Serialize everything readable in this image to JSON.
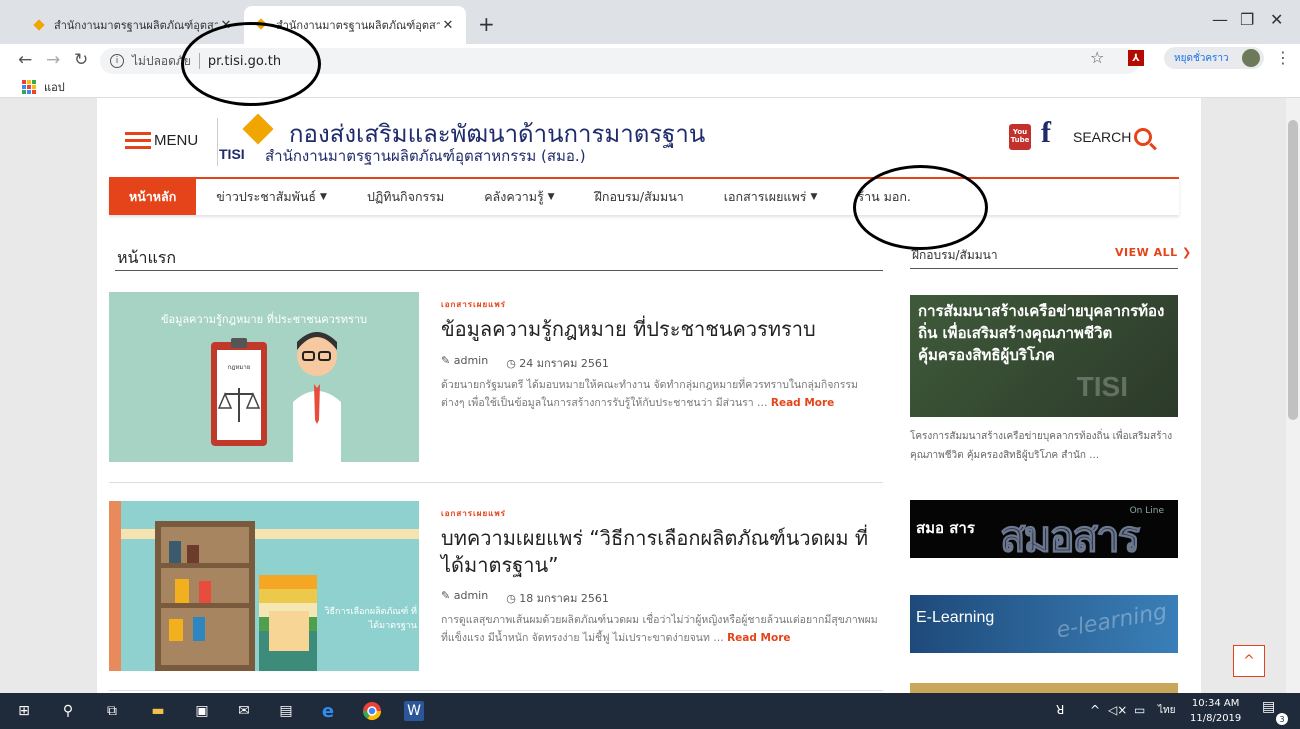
{
  "browser": {
    "tabs": [
      {
        "title": "สำนักงานมาตรฐานผลิตภัณฑ์อุตสาหกรรม",
        "active": false
      },
      {
        "title": "สำนักงานมาตรฐานผลิตภัณฑ์อุตสาหกรรม",
        "active": true
      }
    ],
    "new_tab": "+",
    "address": {
      "security_label": "ไม่ปลอดภัย",
      "url": "pr.tisi.go.th"
    },
    "profile_label": "หยุดชั่วคราว",
    "bookmarks": {
      "apps_label": "แอป"
    }
  },
  "site": {
    "menu_label": "MENU",
    "logo_line1": "กองส่งเสริมและพัฒนาด้านการมาตรฐาน",
    "logo_tisi": "TISI",
    "logo_line2": "สำนักงานมาตรฐานผลิตภัณฑ์อุตสาหกรรม (สมอ.)",
    "youtube_top": "You",
    "youtube_bottom": "Tube",
    "facebook": "f",
    "search_label": "SEARCH",
    "nav": {
      "home": "หน้าหลัก",
      "news": "ข่าวประชาสัมพันธ์",
      "activities": "ปฏิทินกิจกรรม",
      "knowledge": "คลังความรู้",
      "training": "ฝึกอบรม/สัมมนา",
      "documents": "เอกสารเผยแพร่",
      "shop": "ร้าน มอก."
    },
    "section_title": "หน้าแรก",
    "posts": [
      {
        "category": "เอกสารเผยแพร่",
        "thumb_caption": "ข้อมูลความรู้กฎหมาย ที่ประชาชนควรทราบ",
        "thumb_label": "กฎหมาย",
        "title": "ข้อมูลความรู้กฎหมาย ที่ประชาชนควรทราบ",
        "author": "admin",
        "date": "24 มกราคม 2561",
        "excerpt": "ด้วยนายกรัฐมนตรี ได้มอบหมายให้คณะทำงาน จัดทำกลุ่มกฎหมายที่ควรทราบในกลุ่มกิจกรรมต่างๆ เพื่อใช้เป็นข้อมูลในการสร้างการรับรู้ให้กับประชาชนว่า มีส่วนรา …",
        "read_more": "Read More"
      },
      {
        "category": "เอกสารเผยแพร่",
        "thumb_caption": "วิธีการเลือกผลิตภัณฑ์ ที่ได้มาตรฐาน",
        "title": "บทความเผยแพร่ “วิธีการเลือกผลิตภัณฑ์นวดผม ที่ได้มาตรฐาน”",
        "author": "admin",
        "date": "18 มกราคม 2561",
        "excerpt": "การดูแลสุขภาพเส้นผมด้วยผลิตภัณฑ์นวดผม เชื่อว่าไม่ว่าผู้หญิงหรือผู้ชายล้วนแต่อยากมีสุขภาพผมที่แข็งแรง มีน้ำหนัก จัดทรงง่าย ไม่ชี้ฟู ไม่เปราะขาดง่ายจนท …",
        "read_more": "Read More"
      }
    ],
    "sidebar": {
      "title": "ฝึกอบรม/สัมมนา",
      "view_all": "VIEW ALL",
      "featured_title": "การสัมมนาสร้างเครือข่ายบุคลากรท้องถิ่น เพื่อเสริมสร้างคุณภาพชีวิต คุ้มครองสิทธิผู้บริโภค",
      "featured_watermark": "TISI",
      "featured_excerpt": "โครงการสัมมนาสร้างเครือข่ายบุคลากรท้องถิ่น เพื่อเสริมสร้างคุณภาพชีวิต คุ้มครองสิทธิผู้บริโภค สำนัก …",
      "banner1_text": "สมอ สาร",
      "banner1_big": "สมอสาร",
      "banner1_online": "On Line",
      "banner2_text": "E-Learning",
      "banner2_watermark": "e-learning"
    },
    "to_top": "^"
  },
  "taskbar": {
    "time": "10:34 AM",
    "date": "11/8/2019",
    "lang": "ไทย",
    "notifications": "3"
  },
  "colors": {
    "accent": "#e5441a",
    "brand_navy": "#1f2b6b",
    "logo_gold": "#f0a500"
  }
}
